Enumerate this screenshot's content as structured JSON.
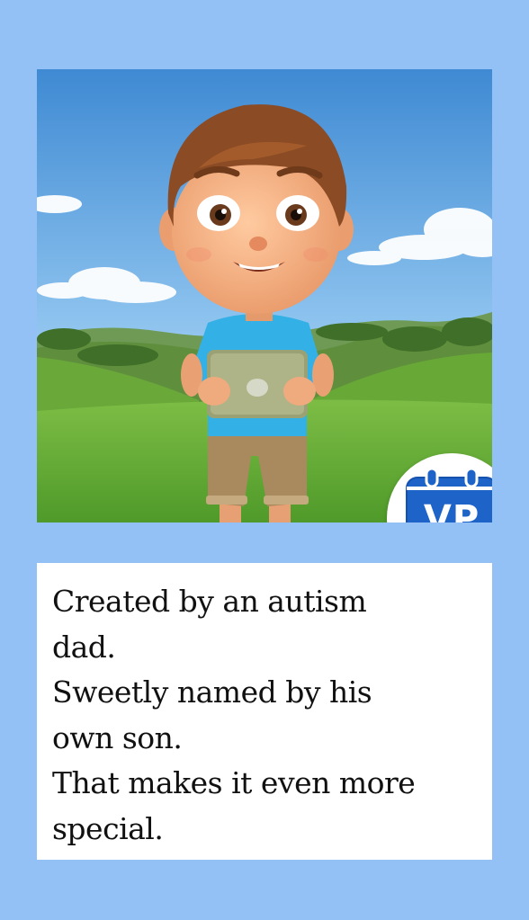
{
  "badge": {
    "text": "VP",
    "icon": "calendar-icon",
    "color": "#1e63c8"
  },
  "caption": {
    "lines": [
      "Created by an autism",
      "dad.",
      "Sweetly named by his",
      "own son.",
      "That makes it even more",
      "special."
    ]
  },
  "colors": {
    "background": "#93c1f5",
    "caption_bg": "#ffffff",
    "sky": "#4a93d6",
    "grass": "#6fb23c",
    "shirt": "#33b0e6"
  }
}
